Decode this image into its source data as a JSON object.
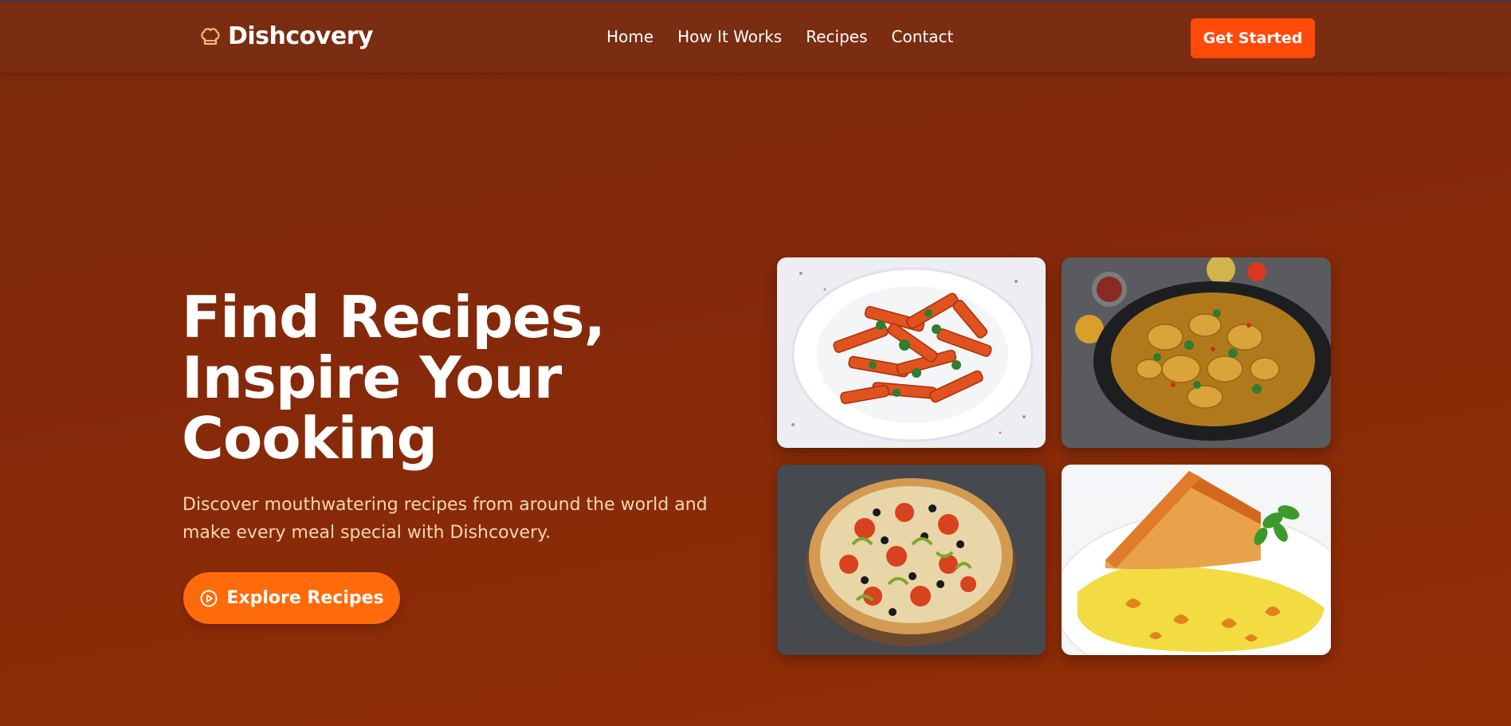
{
  "brand": {
    "name": "Dishcovery",
    "icon": "chef-hat-icon"
  },
  "nav": {
    "items": [
      {
        "label": "Home"
      },
      {
        "label": "How It Works"
      },
      {
        "label": "Recipes"
      },
      {
        "label": "Contact"
      }
    ]
  },
  "header": {
    "cta_label": "Get Started"
  },
  "hero": {
    "title_line1": "Find Recipes,",
    "title_line2": "Inspire Your",
    "title_line3": "Cooking",
    "subtitle": "Discover mouthwatering recipes from around the world and make every meal special with Dishcovery.",
    "button_label": "Explore Recipes",
    "button_icon": "play-circle-icon"
  },
  "gallery": {
    "images": [
      {
        "name": "penne-pasta-image"
      },
      {
        "name": "chicken-curry-image"
      },
      {
        "name": "pizza-image"
      },
      {
        "name": "cake-slice-image"
      }
    ]
  },
  "colors": {
    "background": "#84290a",
    "header": "#7a2d10",
    "accent": "#ff4a0a",
    "button": "#ff6a0a",
    "subtitle": "#f7d7b5",
    "logo_icon": "#ffb57a"
  }
}
